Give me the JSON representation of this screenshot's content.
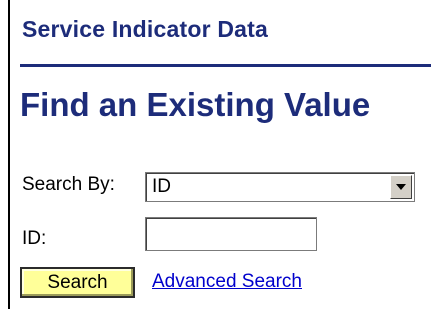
{
  "header": {
    "title": "Service Indicator Data"
  },
  "page": {
    "title": "Find an Existing Value"
  },
  "form": {
    "search_by_label": "Search By:",
    "search_by_value": "ID",
    "id_label": "ID:",
    "id_value": ""
  },
  "actions": {
    "search_label": "Search",
    "advanced_search_label": "Advanced Search"
  },
  "colors": {
    "heading": "#1d2c7a",
    "button_bg": "#ffff99",
    "link": "#0000cc"
  },
  "icons": {
    "dropdown": "chevron-down-icon"
  }
}
